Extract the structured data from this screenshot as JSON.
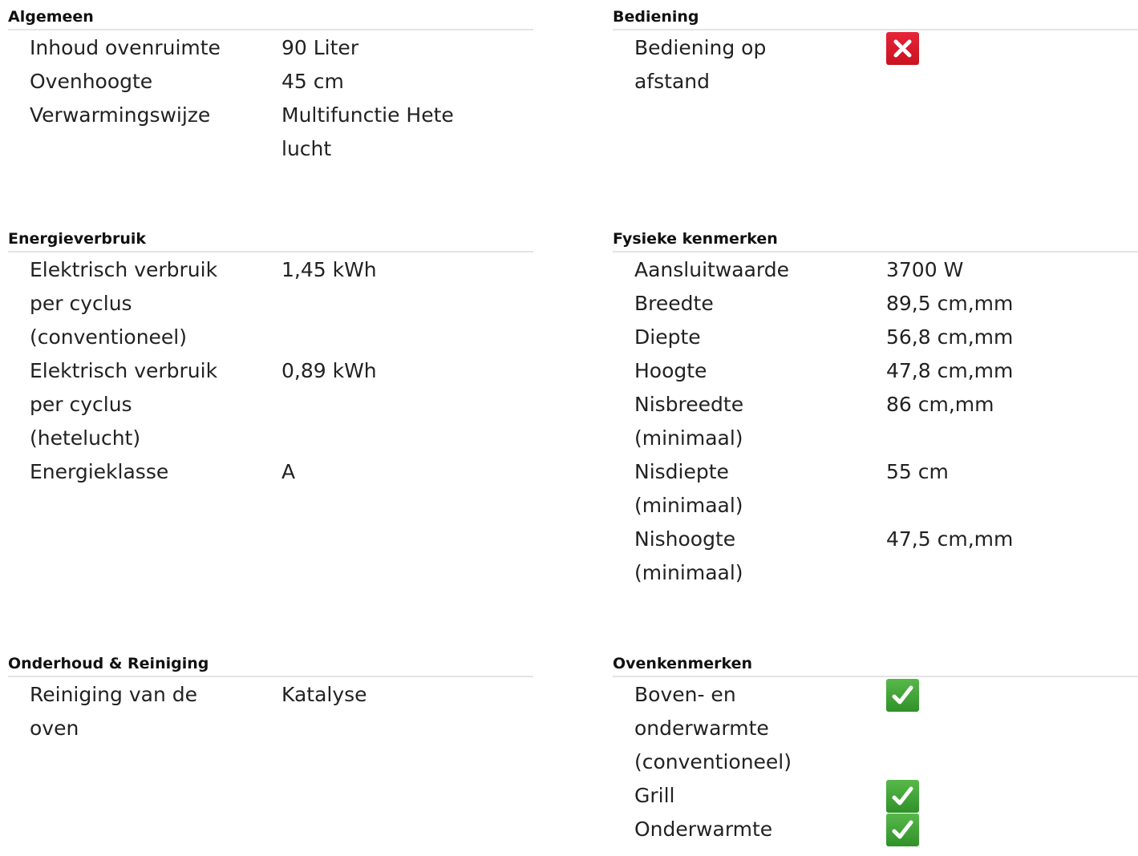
{
  "sections": {
    "algemeen": {
      "title": "Algemeen",
      "rows": [
        {
          "label": "Inhoud ovenruimte",
          "value": "90 Liter"
        },
        {
          "label": "Ovenhoogte",
          "value": "45 cm"
        },
        {
          "label": "Verwarmingswijze",
          "value": "Multifunctie Hete lucht"
        }
      ]
    },
    "bediening": {
      "title": "Bediening",
      "rows": [
        {
          "label": "Bediening op afstand",
          "value_icon": "cross-icon",
          "value": false
        }
      ]
    },
    "energieverbruik": {
      "title": "Energieverbruik",
      "rows": [
        {
          "label": "Elektrisch verbruik per cyclus (conventioneel)",
          "value": "1,45 kWh"
        },
        {
          "label": "Elektrisch verbruik per cyclus (hetelucht)",
          "value": "0,89 kWh"
        },
        {
          "label": "Energieklasse",
          "value": "A"
        }
      ]
    },
    "fysieke_kenmerken": {
      "title": "Fysieke kenmerken",
      "rows": [
        {
          "label": "Aansluitwaarde",
          "value": "3700 W"
        },
        {
          "label": "Breedte",
          "value": "89,5 cm,mm"
        },
        {
          "label": "Diepte",
          "value": "56,8 cm,mm"
        },
        {
          "label": "Hoogte",
          "value": "47,8 cm,mm"
        },
        {
          "label": "Nisbreedte (minimaal)",
          "value": "86 cm,mm"
        },
        {
          "label": "Nisdiepte (minimaal)",
          "value": "55 cm"
        },
        {
          "label": "Nishoogte (minimaal)",
          "value": "47,5 cm,mm"
        }
      ]
    },
    "onderhoud": {
      "title": "Onderhoud & Reiniging",
      "rows": [
        {
          "label": "Reiniging van de oven",
          "value": "Katalyse"
        }
      ]
    },
    "ovenkenmerken": {
      "title": "Ovenkenmerken",
      "rows": [
        {
          "label": "Boven- en onderwarmte (conventioneel)",
          "value_icon": "check-icon",
          "value": true
        },
        {
          "label": "Grill",
          "value_icon": "check-icon",
          "value": true
        },
        {
          "label": "Onderwarmte",
          "value_icon": "check-icon",
          "value": true
        }
      ]
    }
  },
  "colors": {
    "cross": "#d81a2b",
    "check": "#43a83a",
    "divider": "#e4e4e4"
  }
}
